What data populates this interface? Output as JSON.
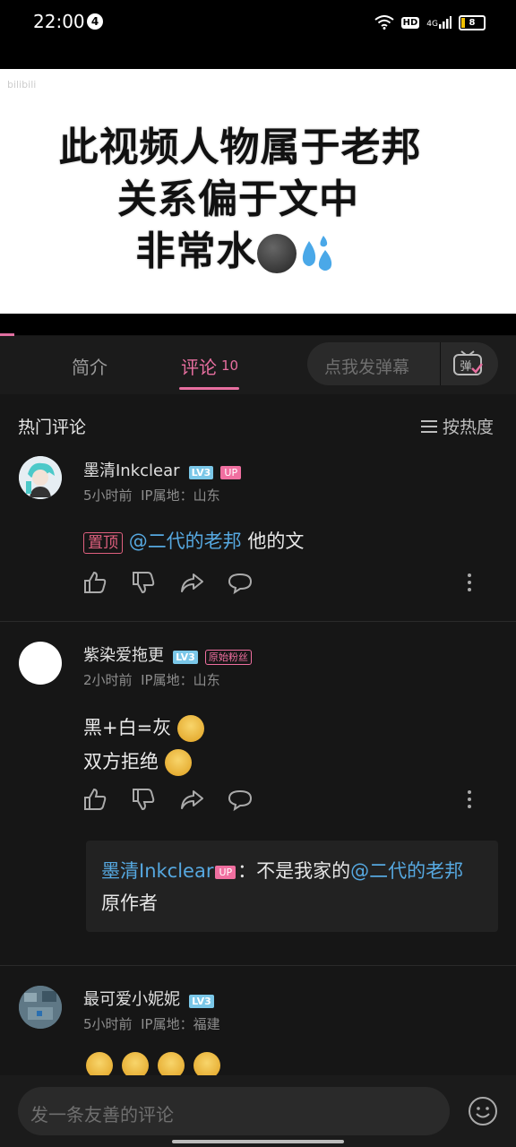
{
  "status_bar": {
    "time": "22:00",
    "notif_count": "4",
    "hd": "HD",
    "network": "4G",
    "battery": "8"
  },
  "video": {
    "watermark": "bilibili",
    "lines": [
      "此视频人物属于老邦",
      "关系偏于文中",
      "非常水"
    ]
  },
  "tabs": {
    "intro": "简介",
    "comments": "评论",
    "comments_count": "10",
    "danmaku_placeholder": "点我发弹幕",
    "danmaku_icon_text": "弹"
  },
  "list_header": {
    "title": "热门评论",
    "sort_label": "按热度"
  },
  "comments": [
    {
      "username": "墨清Inkclear",
      "level": "LV3",
      "badge": "UP",
      "time": "5小时前",
      "ip": "IP属地：山东",
      "pinned_label": "置顶",
      "mention": "@二代的老邦",
      "text": " 他的文"
    },
    {
      "username": "紫染爱拖更",
      "level": "LV3",
      "badge": "原始粉丝",
      "time": "2小时前",
      "ip": "IP属地：山东",
      "lines": [
        "黑+白=灰",
        "双方拒绝"
      ],
      "reply": {
        "user": "墨清Inkclear",
        "badge": "UP",
        "sep": "：不是我家的",
        "mention": "@二代的老邦",
        "text": " 原作者"
      }
    },
    {
      "username": "最可爱小妮妮",
      "level": "LV3",
      "time": "5小时前",
      "ip": "IP属地：福建"
    }
  ],
  "bottom": {
    "placeholder": "发一条友善的评论"
  },
  "colors": {
    "accent": "#e86fa0",
    "mention": "#56a8e0",
    "background": "#161616"
  }
}
